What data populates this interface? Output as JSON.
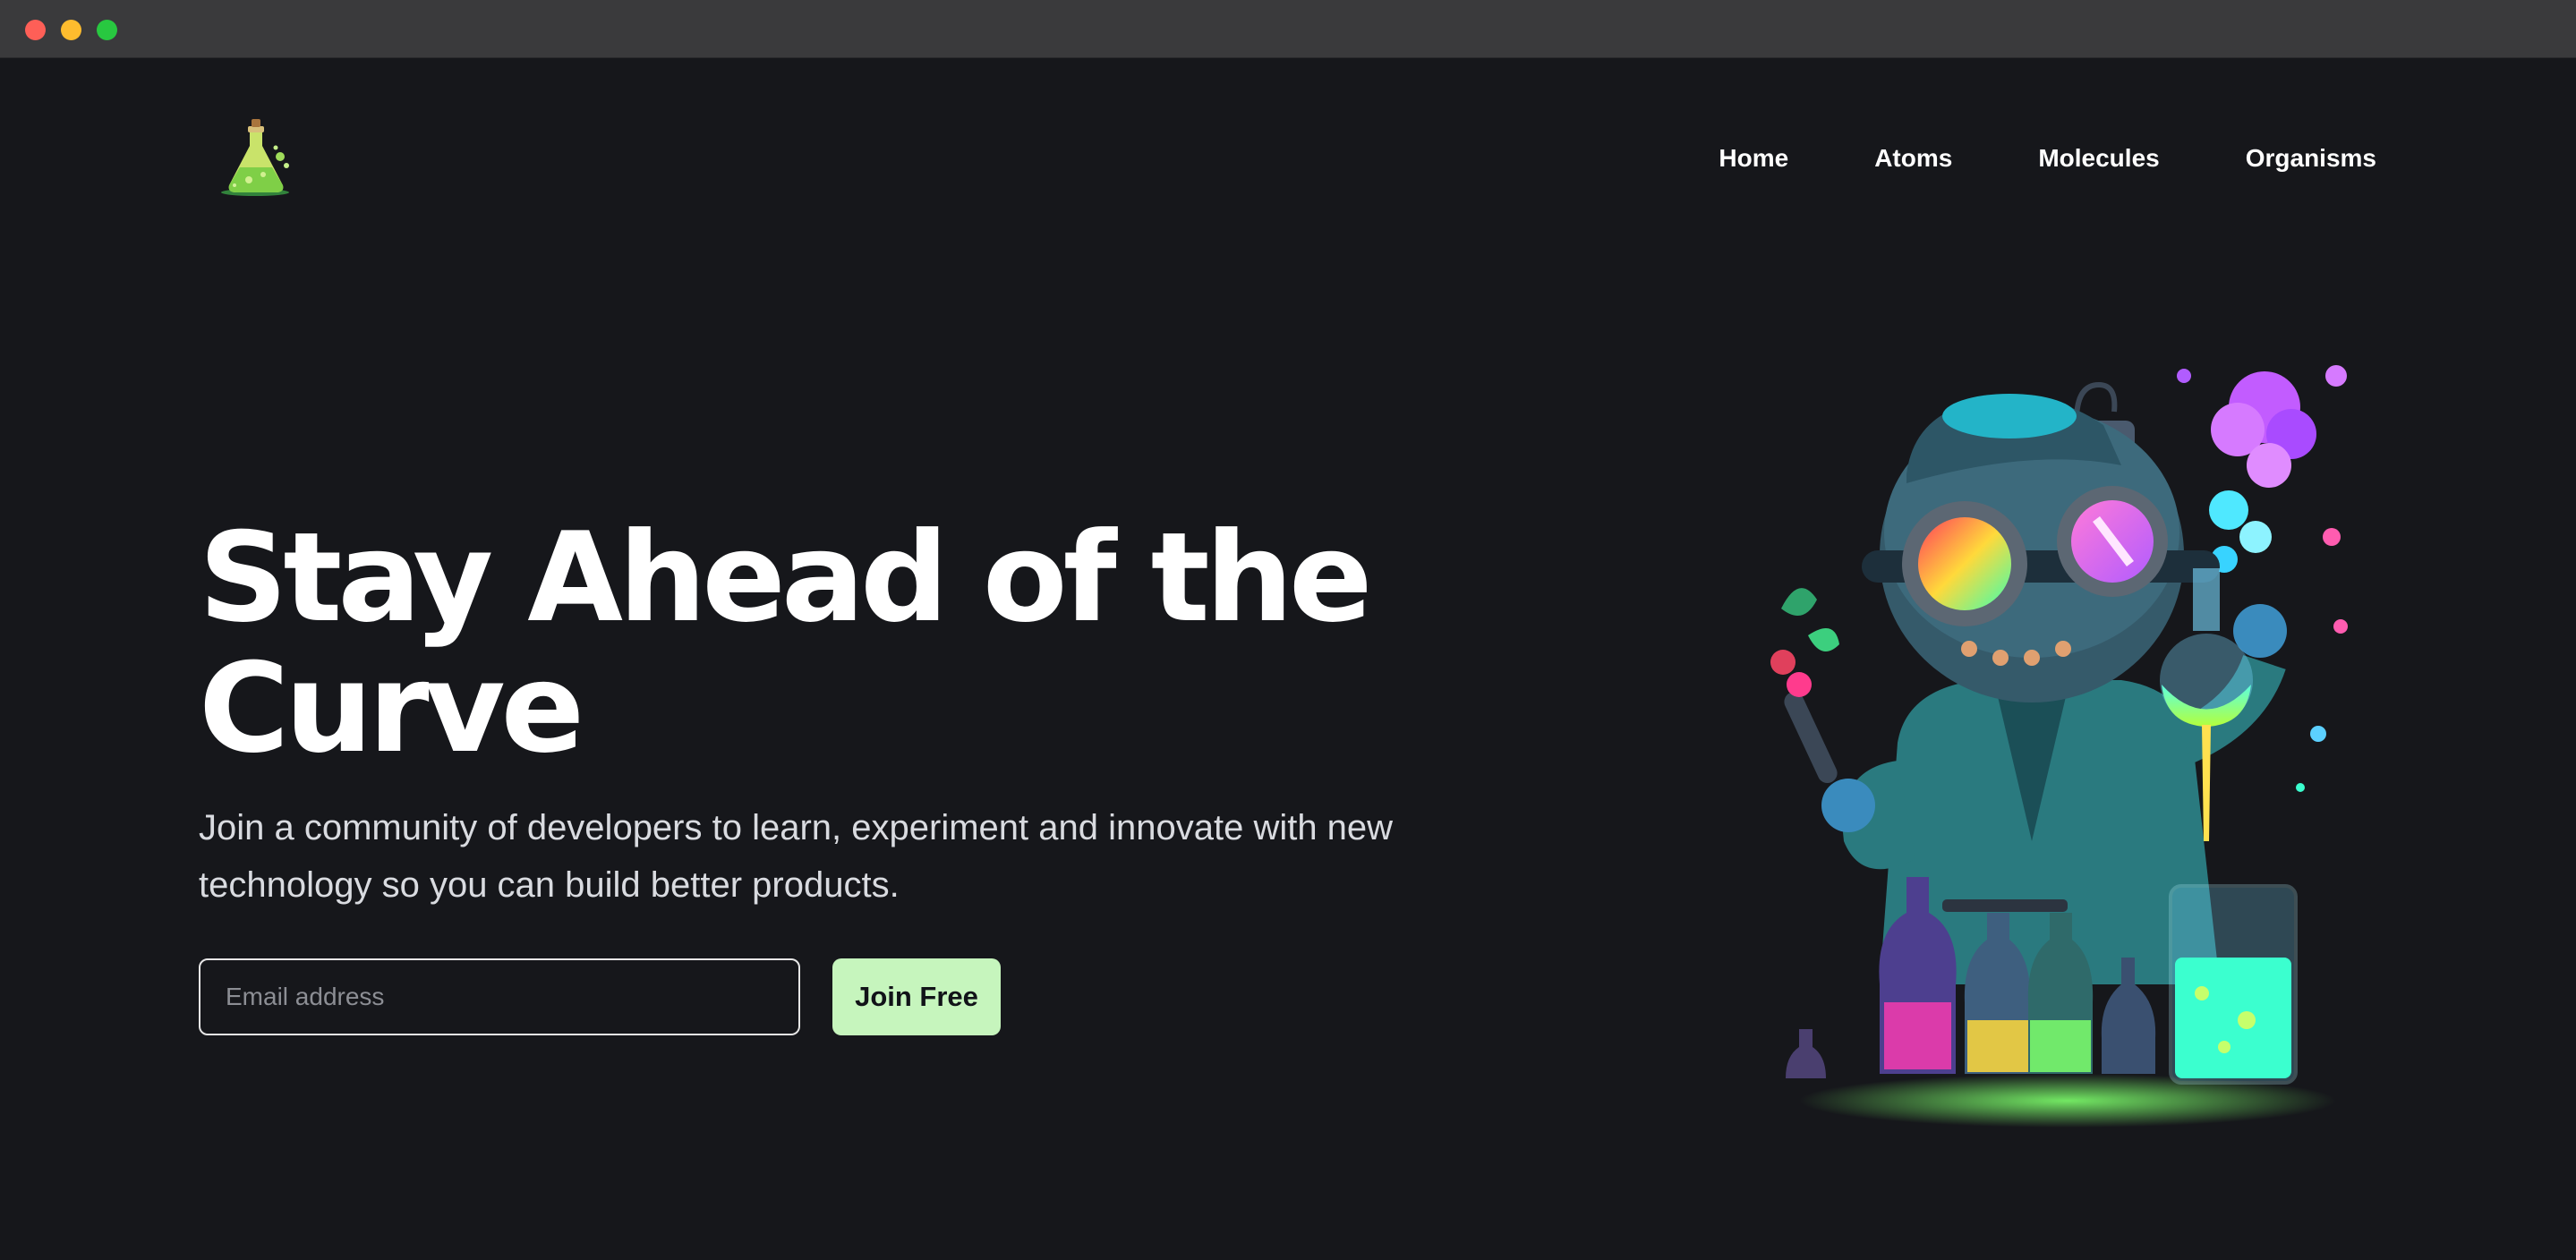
{
  "window": {
    "controls": [
      "close",
      "minimize",
      "maximize"
    ]
  },
  "nav": {
    "logo_icon": "flask-icon",
    "items": [
      {
        "label": "Home"
      },
      {
        "label": "Atoms"
      },
      {
        "label": "Molecules"
      },
      {
        "label": "Organisms"
      }
    ]
  },
  "hero": {
    "title_line1": "Stay Ahead of the",
    "title_line2": "Curve",
    "subtitle": "Join a community of developers to learn, experiment and innovate with new technology so you can build better products.",
    "email_placeholder": "Email address",
    "email_value": "",
    "cta_label": "Join Free",
    "illustration_icon": "mad-scientist-illustration"
  },
  "colors": {
    "background": "#16171b",
    "titlebar": "#3a3a3c",
    "cta_background": "#c6f5bd",
    "text": "#ffffff",
    "subtitle_text": "#d9dbe0"
  }
}
